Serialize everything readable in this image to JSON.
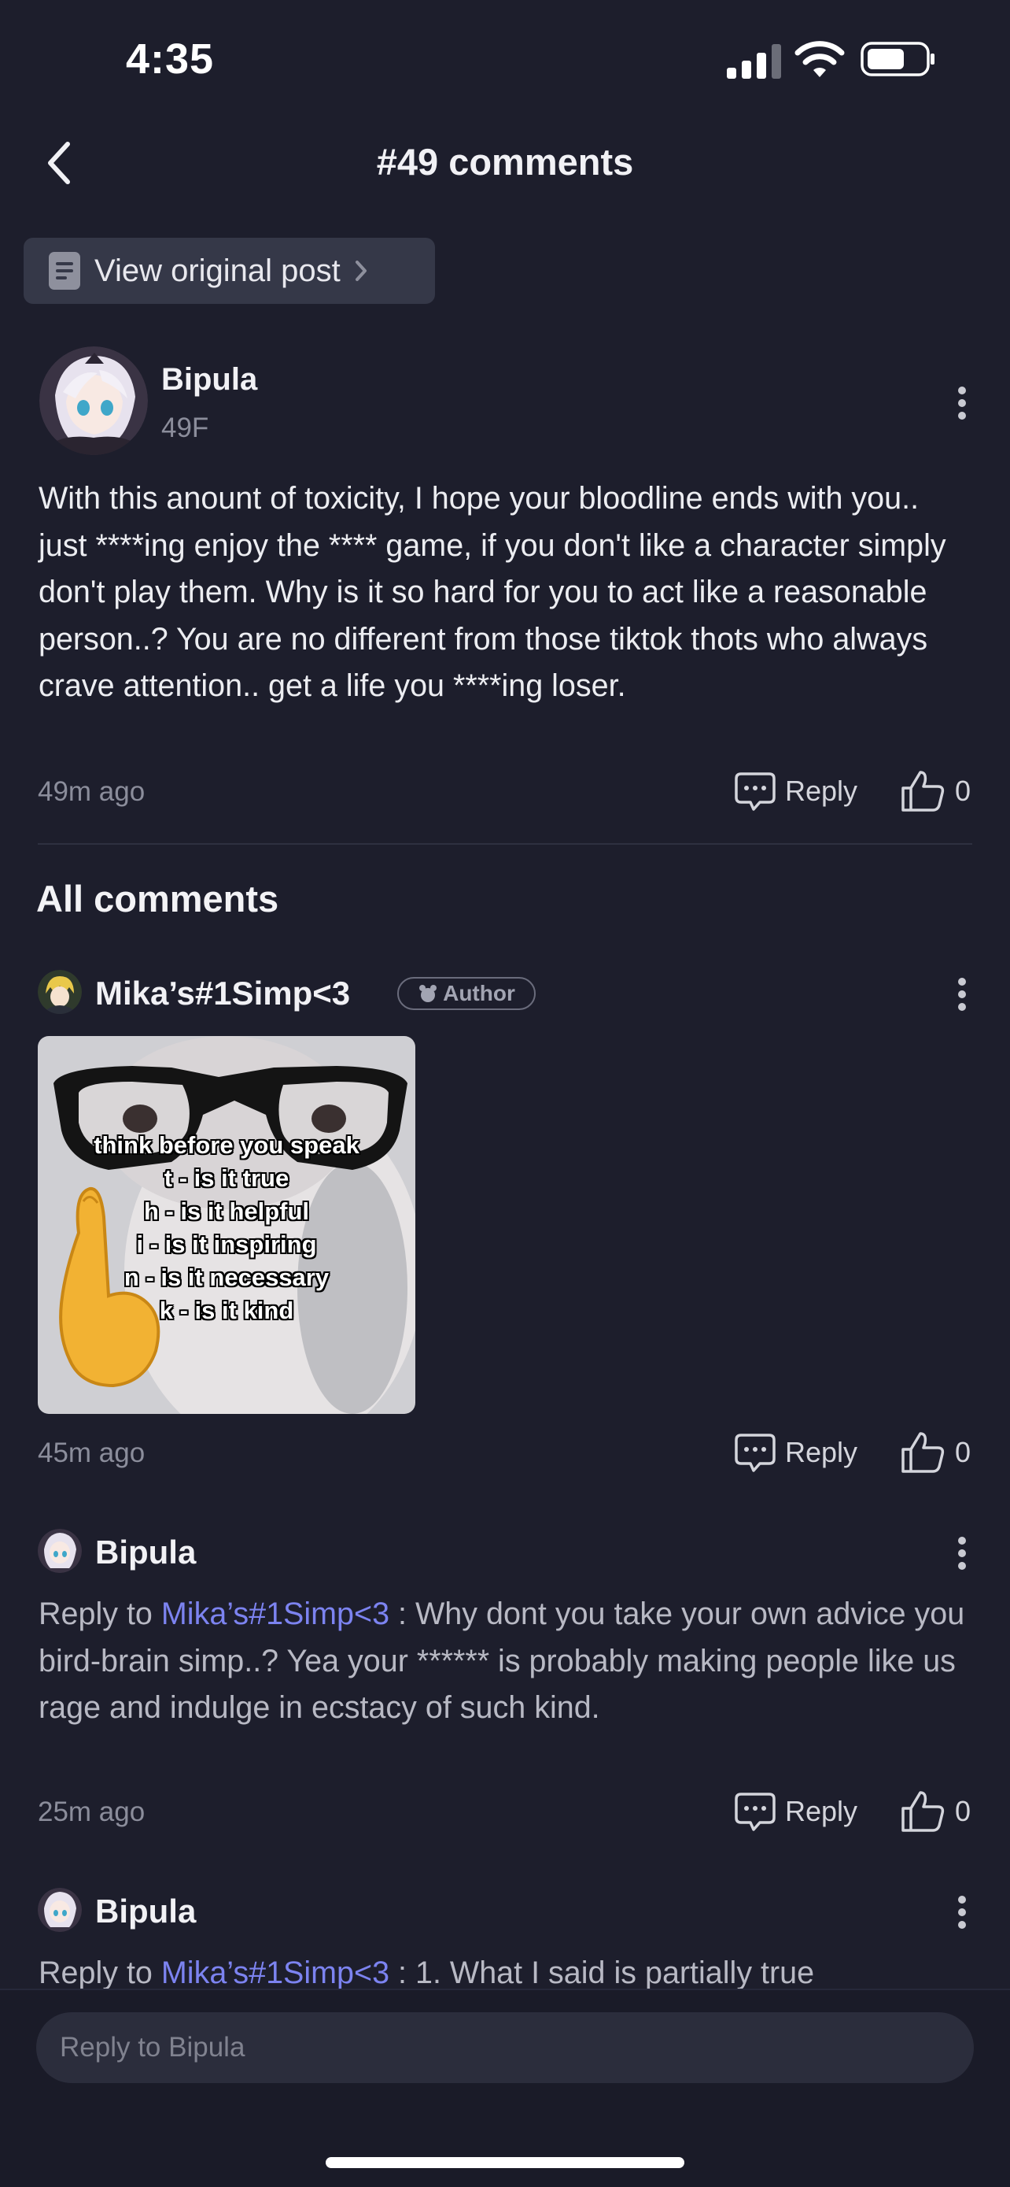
{
  "status_bar": {
    "time": "4:35"
  },
  "header": {
    "title": "#49 comments"
  },
  "original_post_button": {
    "label": "View original post"
  },
  "main_comment": {
    "author": "Bipula",
    "floor": "49F",
    "text": "With this anount of toxicity, I hope your bloodline ends with you.. just ****ing enjoy the **** game, if you don't like a character simply don't play them. Why is it so hard for you to act like a reasonable person..? You are no different from those tiktok thots who always crave attention.. get a life you ****ing loser.",
    "time": "49m ago",
    "reply_label": "Reply",
    "likes": "0"
  },
  "all_comments_title": "All comments",
  "comments": [
    {
      "author": "Mika’s#1Simp<3",
      "badge": "Author",
      "image_text": [
        "think before you speak",
        "t - is it true",
        "h - is it helpful",
        "i - is it inspiring",
        "n - is it necessary",
        "k - is it kind"
      ],
      "time": "45m ago",
      "reply_label": "Reply",
      "likes": "0"
    },
    {
      "author": "Bipula",
      "reply_prefix": "Reply to ",
      "mention": "Mika’s#1Simp<3",
      "text": " : Why dont you take your own advice you bird-brain simp..? Yea your ****** is probably making people like us rage and indulge in ecstacy of such kind.",
      "time": "25m ago",
      "reply_label": "Reply",
      "likes": "0"
    },
    {
      "author": "Bipula",
      "reply_prefix": "Reply to ",
      "mention": "Mika’s#1Simp<3",
      "text": " : 1. What I said is partially true"
    }
  ],
  "reply_input": {
    "placeholder": "Reply to Bipula"
  },
  "colors": {
    "background": "#1d1e2c",
    "mention": "#7c83f0",
    "muted": "#8b8d9b"
  }
}
